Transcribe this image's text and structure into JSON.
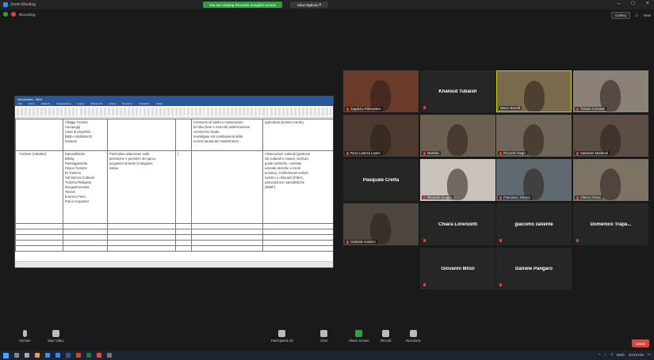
{
  "window": {
    "title": "Zoom Meeting",
    "share_status": "You are viewing Riccardo Scoglio's screen",
    "view_options": "View Options",
    "min": "–",
    "max": "□",
    "close": "×"
  },
  "recording": {
    "label": "Recording"
  },
  "top_right": {
    "view_btn": "Gallery",
    "view_label": "View"
  },
  "document": {
    "title": "Documento1 - Word",
    "menu": [
      "File",
      "Home",
      "Inserisci",
      "Progettazione",
      "Layout",
      "Riferimenti",
      "Lettere",
      "Revisione",
      "Visualizza",
      "Guida"
    ],
    "row1": {
      "c1": "",
      "c2": "Villaggi Turistici\nCampeggi\nCase di proprietà\nB&B e stabilimenti\nbalneari",
      "c3": "",
      "c4": "",
      "c5": "Consorzio di tutela e Associazioni\nDi citta (fiere e mercati) valorizzazione\ncommercio locale.\nInvestigare sui cambiamenti della\nrecenti durata dei trasferimenti.",
      "c6": "agricoltura (turismo verde)."
    },
    "row2": {
      "c1": "- Turismo (Attrattivi)",
      "c2": "Naturalistiche\nBiking\nPaesaggistiche\nPesca Turismo\nEt Turismo\nSiti Storico-Culturali\nTurismo Religioso\nEnogastronomia\nTermal\nEventi e Fiere\nParco Acquatico",
      "c3": "Particolare attenzione sulla\nprecisione e pensiero del parco\nacquatico durante la stagione\nestiva.",
      "c4": "",
      "c5": "",
      "c6": "Associazioni culturali (gestione\nsiti culturali e musei), archivio,\nguide turistiche, comitato\naziende storiche e locali\nturismo). Conferimenti settore\nturismo e ristoranti (FIBA),\nassociazione naturalistiche\n(WWF)."
    },
    "cursor": "|"
  },
  "participants": [
    {
      "name": "Zagabria Rifensalem",
      "video": true,
      "muted": true
    },
    {
      "name": "Khaloud Tubaish",
      "video": false,
      "muted": true
    },
    {
      "name": "Marco Benelli",
      "video": true,
      "muted": false,
      "active": true
    },
    {
      "name": "Tiziano Coronelli",
      "video": true,
      "muted": true
    },
    {
      "name": "Rosa Laterza Lastra",
      "video": true,
      "muted": true
    },
    {
      "name": "Mariella",
      "video": true,
      "muted": true
    },
    {
      "name": "Riccardo Negri",
      "video": true,
      "muted": true
    },
    {
      "name": "Salvatore Manfredi",
      "video": true,
      "muted": true
    },
    {
      "name": "Pasquale Cretta",
      "video": false,
      "muted": false
    },
    {
      "name": "Riccardo Scoglio",
      "video": true,
      "muted": true
    },
    {
      "name": "Francesco Novaro",
      "video": true,
      "muted": true
    },
    {
      "name": "Vittorio Rosso",
      "video": true,
      "muted": true
    },
    {
      "name": "Gabriele Anselmi",
      "video": true,
      "muted": true
    },
    {
      "name": "Chiara Lorenzetti",
      "video": false,
      "muted": true
    },
    {
      "name": "giacomo zaliente",
      "video": false,
      "muted": true
    },
    {
      "name": "Domenico Trapa...",
      "video": false,
      "muted": true
    },
    {
      "name": "Giovanni Minzi",
      "video": false,
      "muted": true
    },
    {
      "name": "Daniele Pangaro",
      "video": false,
      "muted": true
    }
  ],
  "toolbar": {
    "unmute": "Unmute",
    "start_video": "Start Video",
    "participants": "Participants",
    "participants_count": "18",
    "chat": "Chat",
    "share": "Share Screen",
    "record": "Record",
    "reactions": "Reactions",
    "leave": "Leave"
  },
  "taskbar": {
    "lang": "ENG",
    "time": "10:43 AM"
  },
  "colors": {
    "share_green": "#2ea043",
    "leave_red": "#e0433c",
    "word_blue": "#2b579a",
    "active_speaker": "#c9d400"
  }
}
